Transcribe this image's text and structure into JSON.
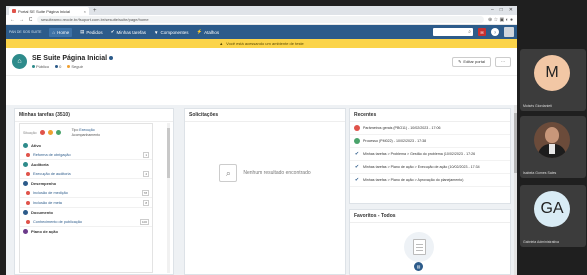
{
  "browser": {
    "tab_title": "Portal SE Suite Página Inicial",
    "url": "sesuiteamo.reode.br/fsuport.com.br/sesuite/suite/page/home",
    "nav_back": "←",
    "nav_forward": "→",
    "nav_reload": "C",
    "new_tab": "+",
    "win_min": "–",
    "win_max": "□",
    "win_close": "✕",
    "addr_icons": "⊕ ☆ ▣ ◐ ●"
  },
  "appnav": {
    "system_label": "PAN DE SOS SUITE",
    "items": [
      {
        "label": "Home",
        "icon": "⌂"
      },
      {
        "label": "Pedidos",
        "icon": "▤"
      },
      {
        "label": "Minhas tarefas",
        "icon": "✔"
      },
      {
        "label": "Componentes",
        "icon": "▼"
      },
      {
        "label": "Atalhos",
        "icon": "⚡"
      }
    ],
    "search_icon": "⌕",
    "bell_icon": "✉",
    "help_icon": "?",
    "settings_icon": "⚙"
  },
  "warning": {
    "icon": "▲",
    "text": "Você está acessando um ambiente de teste"
  },
  "page": {
    "title": "SE Suite Página Inicial",
    "logo_icon": "⌂",
    "meta_public": "Público",
    "meta_count": "0",
    "meta_follow": "Seguir",
    "edit_button": "Editar portal",
    "edit_icon": "✎",
    "more_button": "···"
  },
  "tasks": {
    "title": "Minhas tarefas (3510)",
    "situation_label": "Situação",
    "type_label": "Tipo",
    "execution_label": "Execução",
    "follow_label": "Acompanhamento",
    "groups": [
      {
        "name": "Ativo",
        "color": "#2e8b8b",
        "rows": [
          {
            "label": "Reforma de obrigação",
            "count": "1"
          }
        ]
      },
      {
        "name": "Auditoria",
        "color": "#2e8b8b",
        "rows": [
          {
            "label": "Execução de auditoria",
            "count": "4"
          }
        ]
      },
      {
        "name": "Desempenho",
        "color": "#2c5b8a",
        "rows": [
          {
            "label": "Inclusão de medição",
            "count": "78"
          },
          {
            "label": "Inclusão de meta",
            "count": "8"
          }
        ]
      },
      {
        "name": "Documento",
        "color": "#2c5b8a",
        "rows": [
          {
            "label": "Conhecimento de publicação",
            "count": "100"
          }
        ]
      },
      {
        "name": "Plano de ação",
        "color": "#6b3a8a",
        "rows": []
      }
    ]
  },
  "requests": {
    "title": "Solicitações",
    "empty_text": "Nenhum resultado encontrado",
    "empty_icon": "⌕"
  },
  "recent": {
    "title": "Recentes",
    "items": [
      {
        "icon": "circle",
        "color": "#e0534a",
        "text": "Parâmetros gerais (PBO11) - 10/02/2023 - 17:06"
      },
      {
        "icon": "circle",
        "color": "#4aa36b",
        "text": "Processo (PM022) - 10/02/2023 - 17:38"
      },
      {
        "icon": "check",
        "color": "#2c5b8a",
        "text": "Minhas tarefas > Problema > Gestão do problema (10/02/2023 - 17:26"
      },
      {
        "icon": "check",
        "color": "#2c5b8a",
        "text": "Minhas tarefas > Plano de ação > Execução de ação (10/02/2023 - 17:34"
      },
      {
        "icon": "check",
        "color": "#2c5b8a",
        "text": "Minhas tarefas > Plano de ação > Aprovação do planejamento)"
      }
    ]
  },
  "favorites": {
    "title": "Favoritos - Todos",
    "badge_icon": "▤"
  },
  "participants": [
    {
      "initials": "M",
      "name": "Moisés Giordanieti",
      "color": "#f2c7a5"
    },
    {
      "initials": "",
      "name": "Isabela Gomes Sales",
      "color": ""
    },
    {
      "initials": "GA",
      "name": "Gabriela Administrativa",
      "color": "#d9ecf5"
    }
  ]
}
